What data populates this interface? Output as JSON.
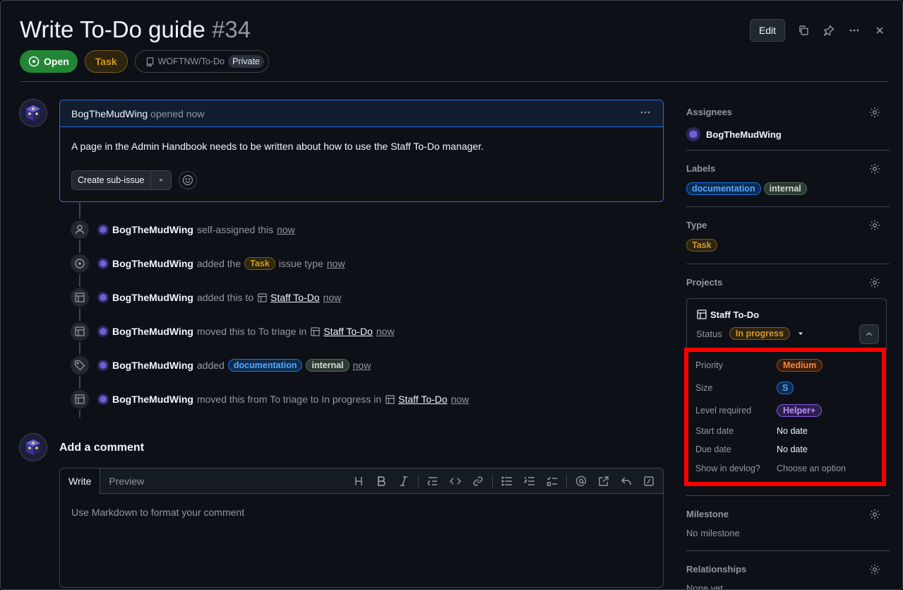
{
  "issue": {
    "title": "Write To-Do guide",
    "number": "#34",
    "state": "Open",
    "type": "Task",
    "repo": "WOFTNW/To-Do",
    "visibility": "Private"
  },
  "header": {
    "edit_label": "Edit",
    "icons": [
      "copy-icon",
      "pin-icon",
      "kebab-icon",
      "close-icon"
    ]
  },
  "comment": {
    "author": "BogTheMudWing",
    "meta": "opened now",
    "body": "A page in the Admin Handbook needs to be written about how to use the Staff To-Do manager.",
    "create_sub_issue": "Create sub-issue"
  },
  "timeline": [
    {
      "icon": "person-icon",
      "user": "BogTheMudWing",
      "parts": [
        "self-assigned this"
      ],
      "when": "now"
    },
    {
      "icon": "issue-open-icon",
      "user": "BogTheMudWing",
      "pre": "added the",
      "label": "Task",
      "post": "issue type",
      "when": "now"
    },
    {
      "icon": "project-table-icon",
      "user": "BogTheMudWing",
      "pre": "added this to",
      "project": "Staff To-Do",
      "when": "now"
    },
    {
      "icon": "project-table-icon",
      "user": "BogTheMudWing",
      "pre": "moved this to To triage in",
      "project": "Staff To-Do",
      "when": "now"
    },
    {
      "icon": "tag-icon",
      "user": "BogTheMudWing",
      "pre": "added",
      "labels": [
        "documentation",
        "internal"
      ],
      "when": "now"
    },
    {
      "icon": "project-table-icon",
      "user": "BogTheMudWing",
      "pre": "moved this from To triage to In progress in",
      "project": "Staff To-Do",
      "when": "now"
    }
  ],
  "add_comment": {
    "title": "Add a comment",
    "tab_write": "Write",
    "tab_preview": "Preview",
    "placeholder": "Use Markdown to format your comment",
    "toolbar": [
      "heading-icon",
      "bold-icon",
      "italic-icon",
      "quote-icon",
      "code-icon",
      "link-icon",
      "unordered-list-icon",
      "ordered-list-icon",
      "tasklist-icon",
      "mention-icon",
      "reference-icon",
      "reply-icon",
      "slash-command-icon"
    ]
  },
  "sidebar": {
    "assignees": {
      "title": "Assignees",
      "user": "BogTheMudWing"
    },
    "labels": {
      "title": "Labels",
      "items": [
        "documentation",
        "internal"
      ]
    },
    "type": {
      "title": "Type",
      "value": "Task"
    },
    "projects": {
      "title": "Projects",
      "project_name": "Staff To-Do",
      "status_key": "Status",
      "status_value": "In progress",
      "fields": [
        {
          "key": "Priority",
          "value": "Medium"
        },
        {
          "key": "Size",
          "value": "S"
        },
        {
          "key": "Level required",
          "value": "Helper+"
        },
        {
          "key": "Start date",
          "value": "No date"
        },
        {
          "key": "Due date",
          "value": "No date"
        },
        {
          "key": "Show in devlog?",
          "value": "Choose an option"
        }
      ]
    },
    "milestone": {
      "title": "Milestone",
      "value": "No milestone"
    },
    "relationships": {
      "title": "Relationships",
      "value": "None yet"
    }
  },
  "colors": {
    "accent_blue": "#1f6feb",
    "open_green": "#238636",
    "highlight_red": "#ff0000",
    "task_orange": "#d29922"
  }
}
